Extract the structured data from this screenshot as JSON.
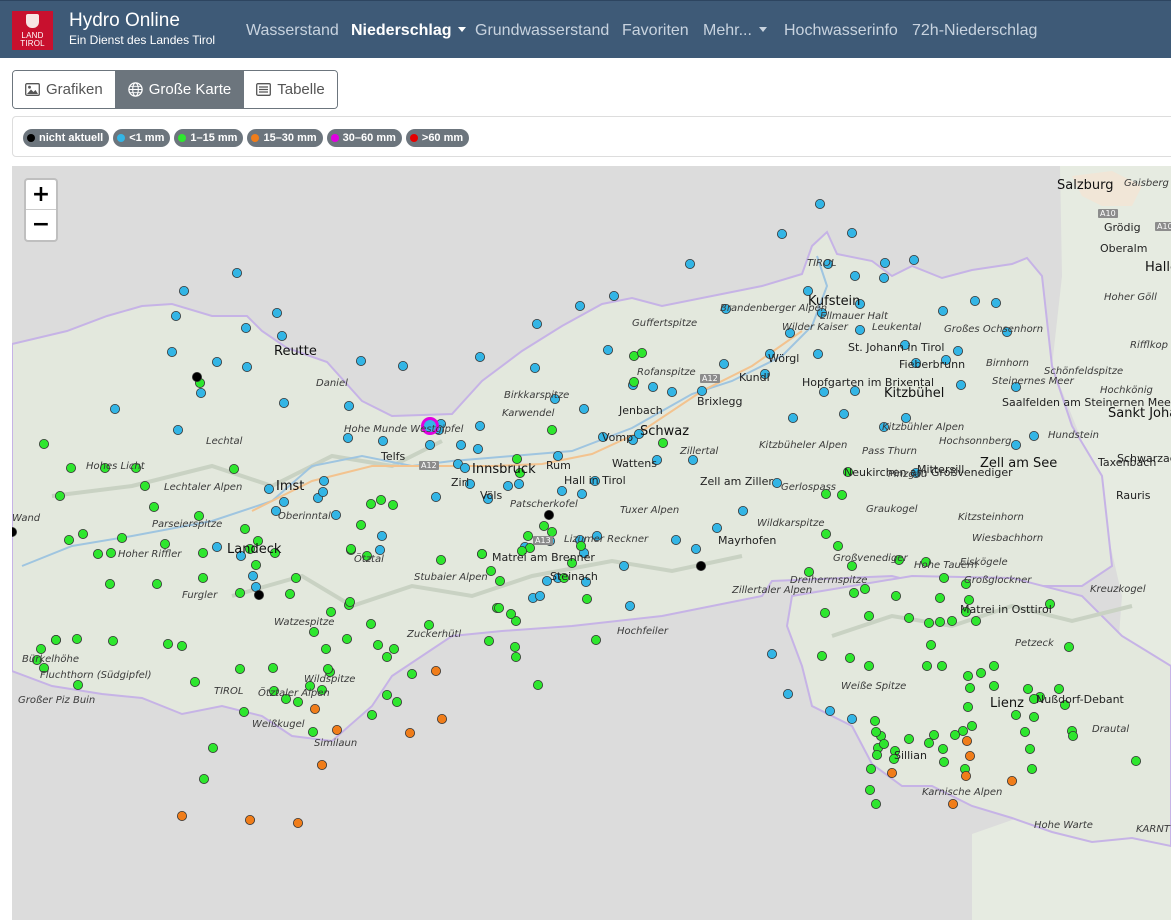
{
  "header": {
    "logo_text": "LAND TIROL",
    "title": "Hydro Online",
    "subtitle": "Ein Dienst des Landes Tirol",
    "nav": [
      {
        "label": "Wasserstand",
        "active": false
      },
      {
        "label": "Niederschlag",
        "active": true,
        "dropdown": true
      },
      {
        "label": "Grundwasserstand",
        "active": false
      },
      {
        "label": "Favoriten",
        "active": false
      },
      {
        "label": "Mehr...",
        "active": false,
        "dropdown": true
      },
      {
        "label": "Hochwasserinfo",
        "active": false
      },
      {
        "label": "72h-Niederschlag",
        "active": false
      }
    ]
  },
  "view_toggle": [
    {
      "label": "Grafiken",
      "icon": "image-icon",
      "active": false
    },
    {
      "label": "Große Karte",
      "icon": "globe-icon",
      "active": true
    },
    {
      "label": "Tabelle",
      "icon": "list-icon",
      "active": false
    }
  ],
  "legend": [
    {
      "label": "nicht aktuell",
      "color": "#000000"
    },
    {
      "label": "<1 mm",
      "color": "#33b5e5"
    },
    {
      "label": "1–15 mm",
      "color": "#2ee62e"
    },
    {
      "label": "15–30 mm",
      "color": "#f07d1a"
    },
    {
      "label": "30–60 mm",
      "color": "#e000e0"
    },
    {
      "label": ">60 mm",
      "color": "#e60000"
    }
  ],
  "map": {
    "zoom_in": "+",
    "zoom_out": "−",
    "places": [
      {
        "name": "Salzburg",
        "kind": "city"
      },
      {
        "name": "Gaisberg",
        "kind": "mtn"
      },
      {
        "name": "Grödig",
        "kind": "town"
      },
      {
        "name": "Oberalm",
        "kind": "town"
      },
      {
        "name": "Halle",
        "kind": "city"
      },
      {
        "name": "Hoher Göll",
        "kind": "mtn"
      },
      {
        "name": "Rifflkop",
        "kind": "mtn"
      },
      {
        "name": "Reutte",
        "kind": "city"
      },
      {
        "name": "Daniel",
        "kind": "mtn"
      },
      {
        "name": "Lechtal",
        "kind": "mtn"
      },
      {
        "name": "Hohes Licht",
        "kind": "mtn"
      },
      {
        "name": "Lechtaler Alpen",
        "kind": "mtn"
      },
      {
        "name": "Imst",
        "kind": "city"
      },
      {
        "name": "Oberinntal",
        "kind": "mtn"
      },
      {
        "name": "Parseierspitze",
        "kind": "mtn"
      },
      {
        "name": "Hoher Riffler",
        "kind": "mtn"
      },
      {
        "name": "Landeck",
        "kind": "city"
      },
      {
        "name": "Furgler",
        "kind": "mtn"
      },
      {
        "name": "Watzespitze",
        "kind": "mtn"
      },
      {
        "name": "Bürkelhöhe",
        "kind": "mtn"
      },
      {
        "name": "Fluchthorn (Südgipfel)",
        "kind": "mtn"
      },
      {
        "name": "Großer Piz Buin",
        "kind": "mtn"
      },
      {
        "name": "Wildspitze",
        "kind": "mtn"
      },
      {
        "name": "Ötztaler Alpen",
        "kind": "mtn"
      },
      {
        "name": "Weißkugel",
        "kind": "mtn"
      },
      {
        "name": "Similaun",
        "kind": "mtn"
      },
      {
        "name": "Wand",
        "kind": "mtn"
      },
      {
        "name": "Hohe Munde Westgipfel",
        "kind": "mtn"
      },
      {
        "name": "Telfs",
        "kind": "town"
      },
      {
        "name": "Ötztal",
        "kind": "mtn"
      },
      {
        "name": "Stubaier Alpen",
        "kind": "mtn"
      },
      {
        "name": "Zuckerhütl",
        "kind": "mtn"
      },
      {
        "name": "Innsbruck",
        "kind": "city"
      },
      {
        "name": "Zirl",
        "kind": "town"
      },
      {
        "name": "Völs",
        "kind": "town"
      },
      {
        "name": "Patscherkofel",
        "kind": "mtn"
      },
      {
        "name": "Rum",
        "kind": "town"
      },
      {
        "name": "Hall in Tirol",
        "kind": "town"
      },
      {
        "name": "Wattens",
        "kind": "town"
      },
      {
        "name": "Matrei am Brenner",
        "kind": "town"
      },
      {
        "name": "Steinach",
        "kind": "town"
      },
      {
        "name": "Lizumer Reckner",
        "kind": "mtn"
      },
      {
        "name": "Hochfeiler",
        "kind": "mtn"
      },
      {
        "name": "Birkkarspitze",
        "kind": "mtn"
      },
      {
        "name": "Karwendel",
        "kind": "mtn"
      },
      {
        "name": "Vomp",
        "kind": "town"
      },
      {
        "name": "Schwaz",
        "kind": "city"
      },
      {
        "name": "Jenbach",
        "kind": "town"
      },
      {
        "name": "Rofanspitze",
        "kind": "mtn"
      },
      {
        "name": "Guffertspitze",
        "kind": "mtn"
      },
      {
        "name": "Brixlegg",
        "kind": "town"
      },
      {
        "name": "Zillertal",
        "kind": "mtn"
      },
      {
        "name": "Tuxer Alpen",
        "kind": "mtn"
      },
      {
        "name": "Zell am Ziller",
        "kind": "town"
      },
      {
        "name": "Mayrhofen",
        "kind": "town"
      },
      {
        "name": "Zillertaler Alpen",
        "kind": "mtn"
      },
      {
        "name": "Brandenberger Alpen",
        "kind": "mtn"
      },
      {
        "name": "Kufstein",
        "kind": "city"
      },
      {
        "name": "Ellmauer Halt",
        "kind": "mtn"
      },
      {
        "name": "Wilder Kaiser",
        "kind": "mtn"
      },
      {
        "name": "Leukental",
        "kind": "mtn"
      },
      {
        "name": "Großes Ochsenhorn",
        "kind": "mtn"
      },
      {
        "name": "Wörgl",
        "kind": "town"
      },
      {
        "name": "Kundl",
        "kind": "town"
      },
      {
        "name": "St. Johann in Tirol",
        "kind": "town"
      },
      {
        "name": "Fieberbrunn",
        "kind": "town"
      },
      {
        "name": "Birnhorn",
        "kind": "mtn"
      },
      {
        "name": "Hopfgarten im Brixental",
        "kind": "town"
      },
      {
        "name": "Kitzbühel",
        "kind": "city"
      },
      {
        "name": "Steinernes Meer",
        "kind": "mtn"
      },
      {
        "name": "Schönfeldspitze",
        "kind": "mtn"
      },
      {
        "name": "Hochkönig",
        "kind": "mtn"
      },
      {
        "name": "Saalfelden am Steinernen Meer",
        "kind": "town"
      },
      {
        "name": "Sankt Johann im Pongau",
        "kind": "city"
      },
      {
        "name": "Hundstein",
        "kind": "mtn"
      },
      {
        "name": "Kitzbühler Alpen",
        "kind": "mtn"
      },
      {
        "name": "Hochsonnberg",
        "kind": "mtn"
      },
      {
        "name": "Kitzbüheler Alpen",
        "kind": "mtn"
      },
      {
        "name": "Pass Thurn",
        "kind": "mtn"
      },
      {
        "name": "Mittersill",
        "kind": "town"
      },
      {
        "name": "Zell am See",
        "kind": "city"
      },
      {
        "name": "Taxenbach",
        "kind": "town"
      },
      {
        "name": "Schwarzach im Pongau",
        "kind": "town"
      },
      {
        "name": "Neukirchen am Großvenediger",
        "kind": "town"
      },
      {
        "name": "Gerlospass",
        "kind": "mtn"
      },
      {
        "name": "Pinzgau",
        "kind": "mtn"
      },
      {
        "name": "Rauris",
        "kind": "town"
      },
      {
        "name": "Wildkarspitze",
        "kind": "mtn"
      },
      {
        "name": "Graukogel",
        "kind": "mtn"
      },
      {
        "name": "Kitzsteinhorn",
        "kind": "mtn"
      },
      {
        "name": "Wiesbachhorn",
        "kind": "mtn"
      },
      {
        "name": "Großvenediger",
        "kind": "mtn"
      },
      {
        "name": "Dreiherrnspitze",
        "kind": "mtn"
      },
      {
        "name": "Hohe Tauern",
        "kind": "mtn"
      },
      {
        "name": "Eiskögele",
        "kind": "mtn"
      },
      {
        "name": "Großglockner",
        "kind": "mtn"
      },
      {
        "name": "Kreuzkogel",
        "kind": "mtn"
      },
      {
        "name": "Matrei in Osttirol",
        "kind": "town"
      },
      {
        "name": "Petzeck",
        "kind": "mtn"
      },
      {
        "name": "Weiße Spitze",
        "kind": "mtn"
      },
      {
        "name": "Lienz",
        "kind": "city"
      },
      {
        "name": "Nußdorf-Debant",
        "kind": "town"
      },
      {
        "name": "Drautal",
        "kind": "mtn"
      },
      {
        "name": "Sillian",
        "kind": "town"
      },
      {
        "name": "Karnische Alpen",
        "kind": "mtn"
      },
      {
        "name": "Hohe Warte",
        "kind": "mtn"
      },
      {
        "name": "KARNT",
        "kind": "mtn"
      },
      {
        "name": "TIROL",
        "kind": "mtn"
      },
      {
        "name": "TIROL",
        "kind": "mtn"
      },
      {
        "name": "A12",
        "kind": "road"
      },
      {
        "name": "A13",
        "kind": "road"
      },
      {
        "name": "A12",
        "kind": "road"
      },
      {
        "name": "A10",
        "kind": "road"
      },
      {
        "name": "A10",
        "kind": "road"
      }
    ]
  }
}
